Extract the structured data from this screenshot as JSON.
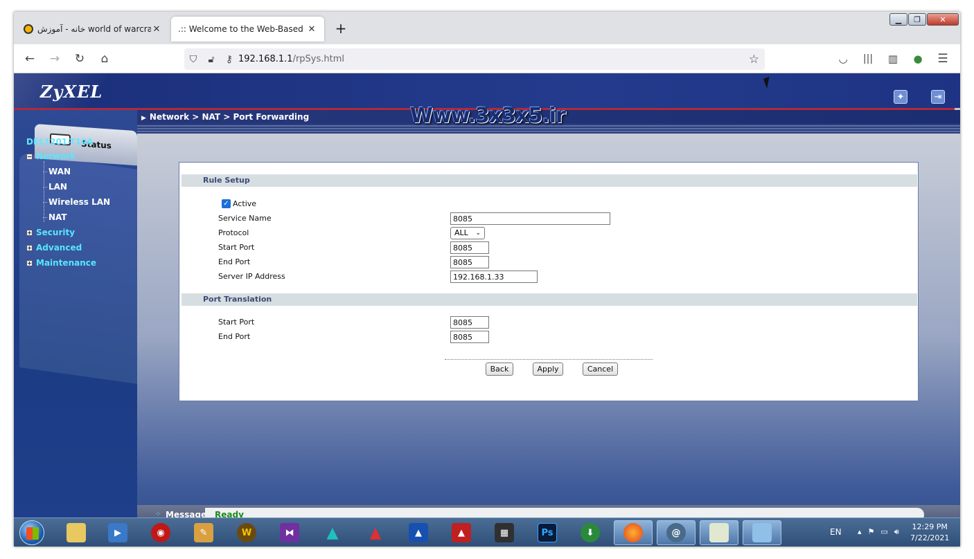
{
  "browser": {
    "tabs": [
      {
        "label": "خانه - آموزش world of warcraft"
      },
      {
        "label": ".:: Welcome to the Web-Based Conf"
      }
    ],
    "url_host": "192.168.1.1",
    "url_path": "/rpSys.html"
  },
  "router": {
    "logo": "ZyXEL",
    "breadcrumb": "Network > NAT > Port Forwarding",
    "watermark": "Www.3x3x5.ir",
    "status_tab": "Status",
    "device_name": "DEL1201-T10A",
    "nav": {
      "network": "Network",
      "network_items": [
        "WAN",
        "LAN",
        "Wireless LAN",
        "NAT"
      ],
      "security": "Security",
      "advanced": "Advanced",
      "maintenance": "Maintenance"
    },
    "rule_setup": {
      "header": "Rule Setup",
      "active_label": "Active",
      "active_checked": true,
      "service_name_label": "Service Name",
      "service_name_value": "8085",
      "protocol_label": "Protocol",
      "protocol_value": "ALL",
      "start_port_label": "Start Port",
      "start_port_value": "8085",
      "end_port_label": "End Port",
      "end_port_value": "8085",
      "server_ip_label": "Server IP Address",
      "server_ip_value": "192.168.1.33"
    },
    "port_translation": {
      "header": "Port Translation",
      "start_port_label": "Start Port",
      "start_port_value": "8085",
      "end_port_label": "End Port",
      "end_port_value": "8085"
    },
    "buttons": {
      "back": "Back",
      "apply": "Apply",
      "cancel": "Cancel"
    },
    "message_label": "Message",
    "message_value": "Ready"
  },
  "taskbar": {
    "lang": "EN",
    "time": "12:29 PM",
    "date": "7/22/2021"
  }
}
